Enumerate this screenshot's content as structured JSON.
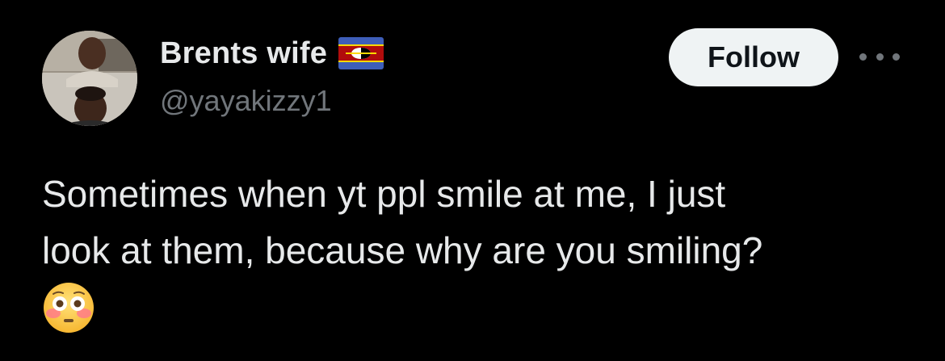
{
  "tweet": {
    "author": {
      "display_name": "Brents wife",
      "handle": "@yayakizzy1",
      "avatar_alt": "profile photo",
      "flag_icon": "eswatini-flag-icon"
    },
    "follow_label": "Follow",
    "more_icon": "more-options-icon",
    "text": "Sometimes when yt ppl smile at me, I just\nlook at them, because why are you smiling?",
    "emoji_icon": "flushed-face-emoji"
  },
  "colors": {
    "background": "#000000",
    "primary_text": "#e7e9ea",
    "secondary_text": "#71767b",
    "follow_button_bg": "#eff3f4",
    "follow_button_text": "#0f1419"
  }
}
